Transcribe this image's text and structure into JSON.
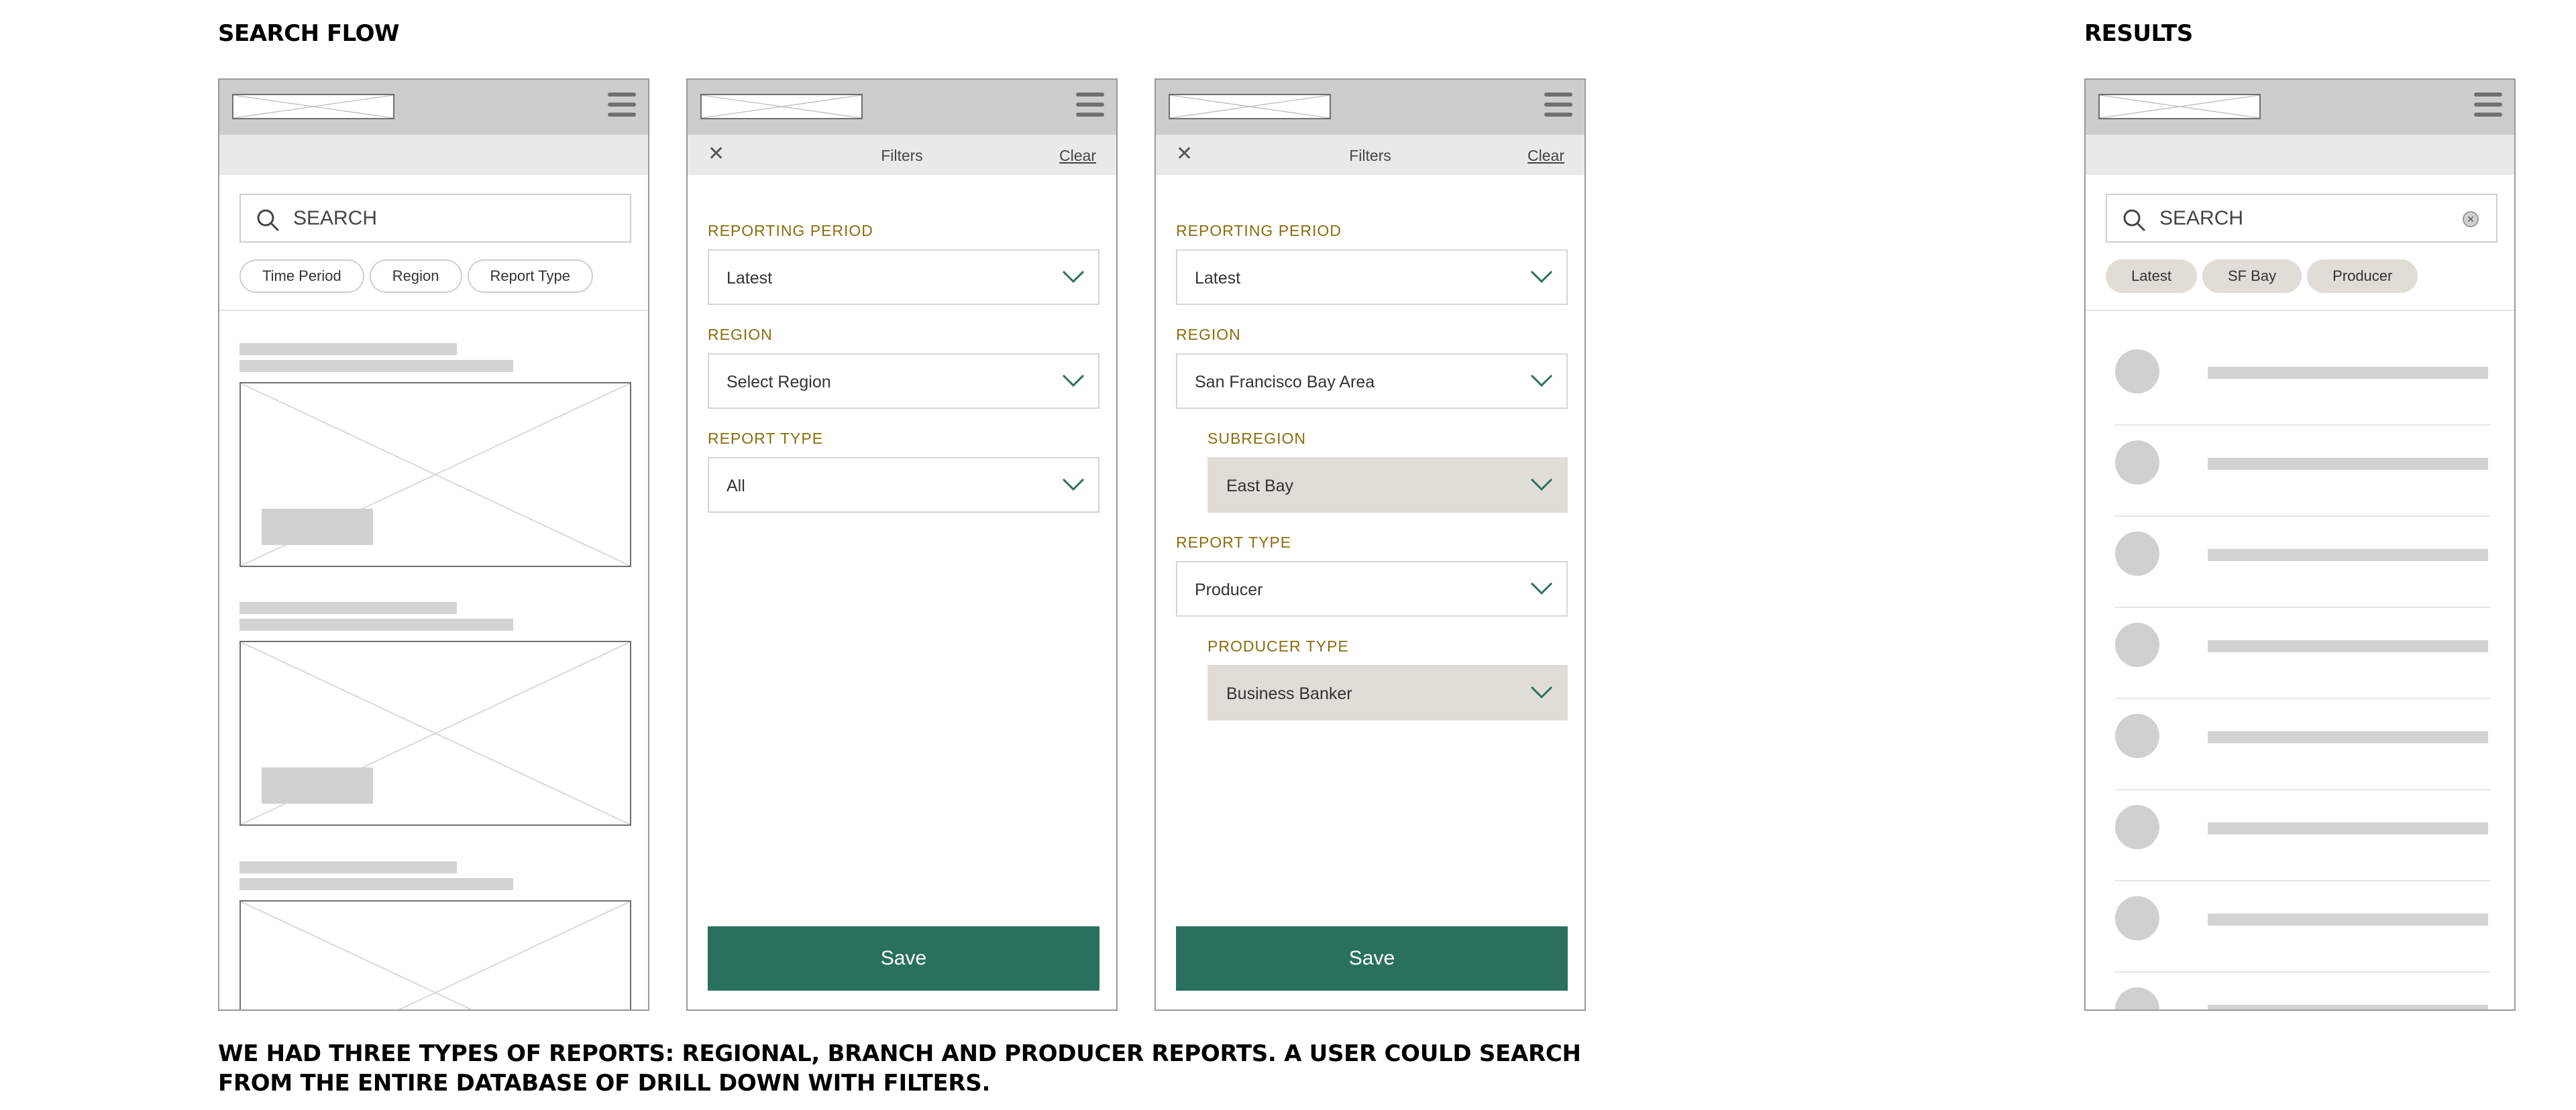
{
  "sections": {
    "search_flow": "SEARCH FLOW",
    "results": "RESULTS"
  },
  "caption": "WE HAD THREE TYPES OF REPORTS: REGIONAL, BRANCH AND PRODUCER REPORTS. A USER COULD SEARCH FROM THE ENTIRE DATABASE OF DRILL DOWN WITH FILTERS.",
  "colors": {
    "accent_green": "#2a705e",
    "label_gold": "#8b6d0f",
    "chip_fill": "#e0ddd7"
  },
  "icons": {
    "menu": "hamburger-menu-icon",
    "search": "search-icon",
    "close": "close-icon",
    "chevron": "chevron-down-icon",
    "clear": "clear-circle-icon"
  },
  "screen1": {
    "search_placeholder": "SEARCH",
    "chips": [
      "Time Period",
      "Region",
      "Report Type"
    ]
  },
  "screen2": {
    "close": "✕",
    "title": "Filters",
    "clear": "Clear",
    "fields": [
      {
        "label": "REPORTING PERIOD",
        "value": "Latest"
      },
      {
        "label": "REGION",
        "value": "Select Region"
      },
      {
        "label": "REPORT TYPE",
        "value": "All"
      }
    ],
    "save": "Save"
  },
  "screen3": {
    "close": "✕",
    "title": "Filters",
    "clear": "Clear",
    "fields": [
      {
        "label": "REPORTING PERIOD",
        "value": "Latest"
      },
      {
        "label": "REGION",
        "value": "San Francisco Bay Area"
      },
      {
        "label": "SUBREGION",
        "value": "East Bay"
      },
      {
        "label": "REPORT TYPE",
        "value": "Producer"
      },
      {
        "label": "PRODUCER TYPE",
        "value": "Business Banker"
      }
    ],
    "save": "Save"
  },
  "screen4": {
    "search_value": "SEARCH",
    "clear": "×",
    "chips": [
      "Latest",
      "SF Bay",
      "Producer"
    ]
  }
}
